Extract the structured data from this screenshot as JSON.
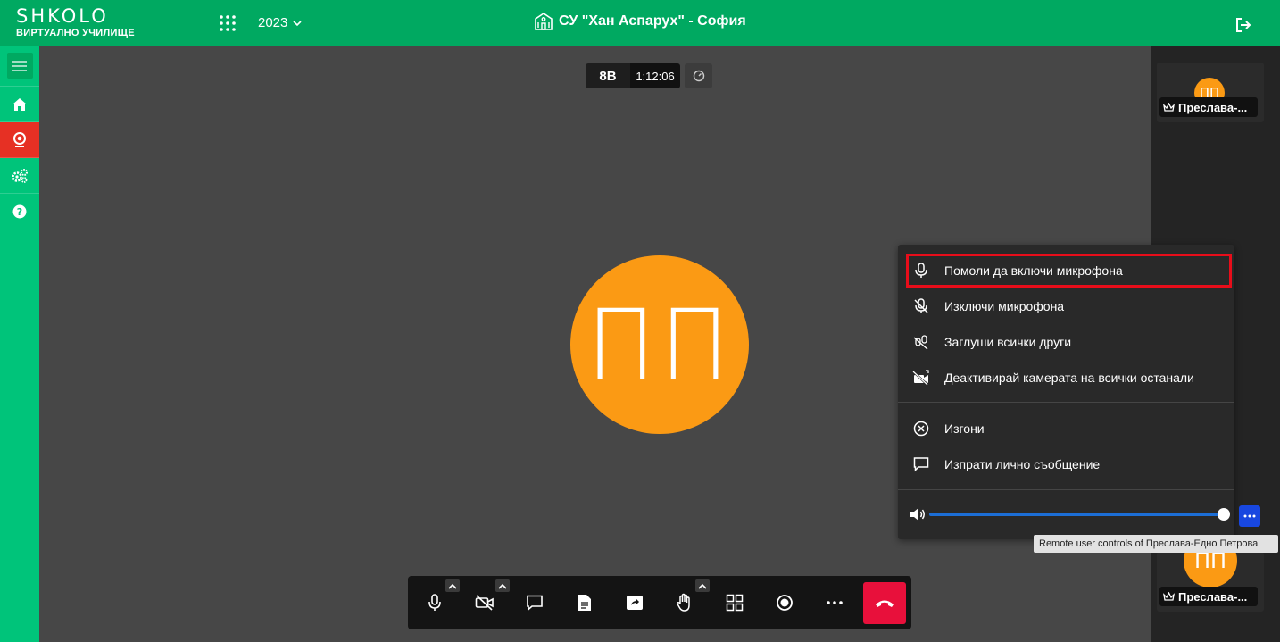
{
  "app": {
    "logo_text": "SHKOLO",
    "logo_subtitle": "ВИРТУАЛНО УЧИЛИЩЕ",
    "year": "2023",
    "school_name": "СУ \"Хан Аспарух\" - София"
  },
  "colors": {
    "brand_green": "#00a961",
    "sidebar_green": "#00c47a",
    "sidebar_active": "#e63024",
    "avatar_orange": "#fb9a14",
    "hangup_red": "#e8103b",
    "highlight_red": "#e80d1a",
    "accent_blue": "#1847e0"
  },
  "sidebar": {
    "items": [
      {
        "icon": "menu-icon"
      },
      {
        "icon": "home-icon"
      },
      {
        "icon": "webcam-icon",
        "active": true
      },
      {
        "icon": "gears-icon"
      },
      {
        "icon": "help-icon"
      }
    ]
  },
  "meeting": {
    "room": "8В",
    "elapsed": "1:12:06",
    "main_avatar_initials": "ПП"
  },
  "participants": [
    {
      "initials": "ПП",
      "name": "Преслава-..."
    },
    {
      "initials": "ПП",
      "name": "Преслава-..."
    }
  ],
  "context_menu": {
    "items": [
      {
        "label": "Помоли да включи микрофона",
        "icon": "microphone-icon"
      },
      {
        "label": "Изключи микрофона",
        "icon": "microphone-off-icon"
      },
      {
        "label": "Заглуши всички други",
        "icon": "mute-all-icon"
      },
      {
        "label": "Деактивирай камерата на всички останали",
        "icon": "camera-off-all-icon"
      },
      {
        "label": "Изгони",
        "icon": "kick-icon"
      },
      {
        "label": "Изпрати лично съобщение",
        "icon": "chat-icon"
      }
    ],
    "volume_level": 1.0
  },
  "tooltip": "Remote user controls of Преслава-Едно Петрова",
  "toolbar": {
    "buttons": [
      "microphone-icon",
      "camera-off-icon",
      "chat-icon",
      "document-icon",
      "share-screen-icon",
      "raise-hand-icon",
      "tile-view-icon",
      "record-icon",
      "more-icon",
      "hangup-icon"
    ]
  }
}
